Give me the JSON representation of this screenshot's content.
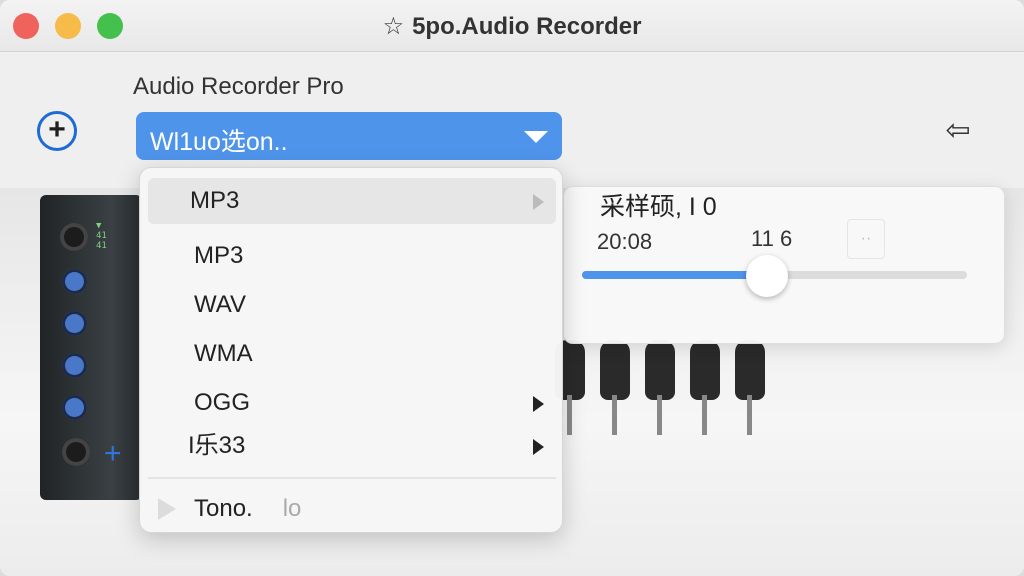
{
  "window": {
    "title": "5po.Audio Recorder",
    "title_icon": "star-icon"
  },
  "toolbar": {
    "app_label": "Audio Recorder Pro",
    "add_icon": "plus-circle-icon",
    "back_icon": "back-arrow-icon",
    "select_value": "Wl1uo选on..",
    "accent_color": "#4e94ea"
  },
  "format_menu": {
    "items": [
      {
        "label": "MP3",
        "has_submenu": true,
        "highlighted": true
      },
      {
        "label": "MP3",
        "has_submenu": false,
        "highlighted": false
      },
      {
        "label": "WAV",
        "has_submenu": false,
        "highlighted": false
      },
      {
        "label": "WMA",
        "has_submenu": false,
        "highlighted": false
      },
      {
        "label": "OGG",
        "has_submenu": true,
        "highlighted": false
      },
      {
        "label": "I乐33",
        "has_submenu": true,
        "highlighted": false
      }
    ],
    "footer": {
      "label": "Tono.",
      "suffix": "lo"
    }
  },
  "sample_panel": {
    "title": "采样硕, I 0",
    "time": "20:08",
    "value": "11 6",
    "tag": "··",
    "slider_level": 0.48
  },
  "device": {
    "knob_icon": "knob-icon",
    "jack_icon": "audio-jack-icon",
    "plus_icon": "plus-icon",
    "led_text": "▼ 41 41"
  }
}
